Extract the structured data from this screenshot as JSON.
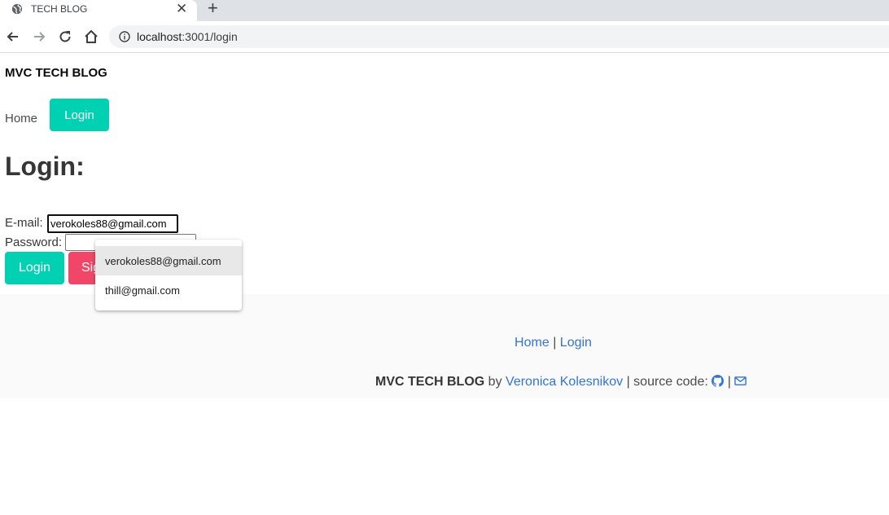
{
  "browser": {
    "tab_title": "TECH BLOG",
    "url_host": "localhost",
    "url_rest": ":3001/login"
  },
  "page": {
    "brand": "MVC TECH BLOG",
    "nav": {
      "home": "Home",
      "login": "Login"
    },
    "title": "Login:",
    "form": {
      "email_label": "E-mail:",
      "email_value": "verokoles88@gmail.com",
      "password_label": "Password:",
      "password_value": "",
      "login_button": "Login",
      "signup_button_visible": "Sig"
    },
    "autofill": [
      "verokoles88@gmail.com",
      "thill@gmail.com"
    ]
  },
  "footer": {
    "home": "Home",
    "separator": "|",
    "login": "Login",
    "brand": "MVC TECH BLOG",
    "by": "by",
    "author": "Veronica Kolesnikov",
    "source_code": "| source code:",
    "icon_separator": "|",
    "icons": [
      "github-icon",
      "envelope-icon"
    ]
  },
  "colors": {
    "primary": "#00d1b2",
    "danger": "#f14668",
    "link": "#3273dc"
  }
}
